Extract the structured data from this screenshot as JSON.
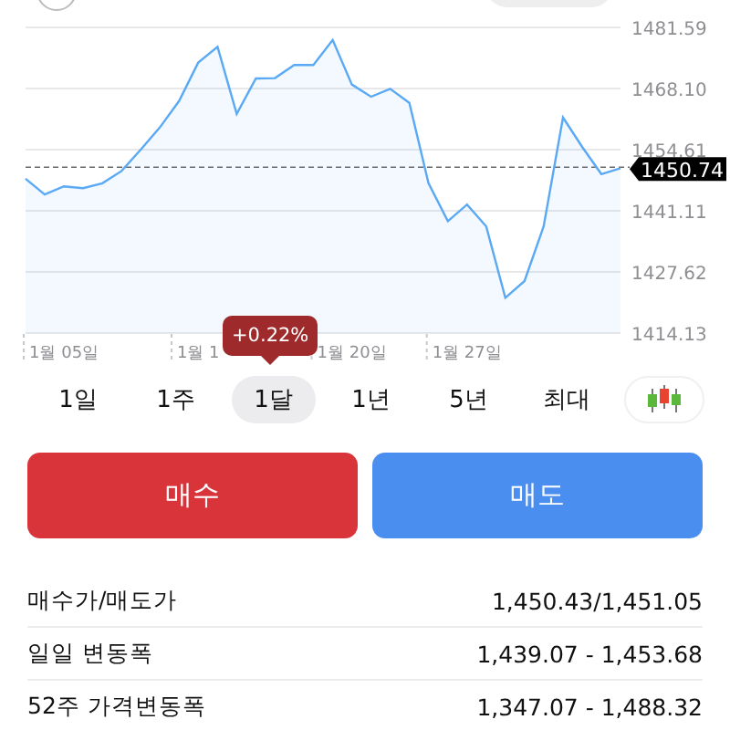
{
  "chart": {
    "chart_data": {
      "type": "area",
      "grid": true,
      "ylim": [
        1414.13,
        1481.59
      ],
      "categories": [
        null,
        null,
        "1월 05일",
        null,
        null,
        null,
        null,
        null,
        null,
        "1월 1",
        null,
        null,
        null,
        null,
        null,
        null,
        null,
        "1월 20일",
        null,
        null,
        null,
        null,
        null,
        "1월 27일",
        null,
        null,
        null,
        null,
        null,
        null,
        null,
        null
      ],
      "yticks": [
        {
          "value": 1481.59,
          "label": "1481.59"
        },
        {
          "value": 1468.1,
          "label": "1468.10"
        },
        {
          "value": 1454.61,
          "label": "1454.61"
        },
        {
          "value": 1441.11,
          "label": "1441.11"
        },
        {
          "value": 1427.62,
          "label": "1427.62"
        },
        {
          "value": 1414.13,
          "label": "1414.13"
        }
      ],
      "series": [
        {
          "color": "#5aa9f5",
          "values": [
            1448.2,
            1444.7,
            1446.5,
            1446.1,
            1447.2,
            1449.9,
            1454.6,
            1459.5,
            1465.3,
            1473.8,
            1477.3,
            1462.5,
            1470.3,
            1470.4,
            1473.3,
            1473.3,
            1478.8,
            1469.0,
            1466.3,
            1468.0,
            1464.9,
            1447.2,
            1438.8,
            1442.5,
            1437.7,
            1421.9,
            1425.6,
            1437.7,
            1461.7,
            1455.2,
            1449.2,
            1450.5
          ]
        }
      ],
      "ref_lines": [
        {
          "axis": "y",
          "value": 1450.74,
          "label": "1450.74"
        }
      ]
    },
    "change_tooltip": "+0.22%"
  },
  "periods": [
    {
      "label": "1일",
      "selected": false
    },
    {
      "label": "1주",
      "selected": false
    },
    {
      "label": "1달",
      "selected": true
    },
    {
      "label": "1년",
      "selected": false
    },
    {
      "label": "5년",
      "selected": false
    },
    {
      "label": "최대",
      "selected": false
    }
  ],
  "actions": [
    {
      "kind": "buy",
      "label": "매수"
    },
    {
      "kind": "sell",
      "label": "매도"
    }
  ],
  "stats": [
    {
      "label": "매수가/매도가",
      "value": "1,450.43/1,451.05"
    },
    {
      "label": "일일 변동폭",
      "value": "1,439.07 - 1,453.68"
    },
    {
      "label": "52주 가격변동폭",
      "value": "1,347.07 - 1,488.32"
    }
  ]
}
